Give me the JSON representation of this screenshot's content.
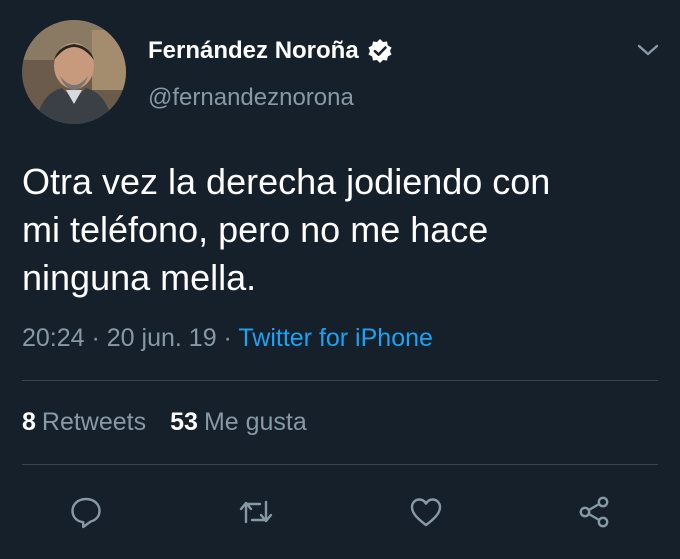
{
  "tweet": {
    "author": {
      "display_name": "Fernández Noroña",
      "handle": "@fernandeznorona",
      "verified": true,
      "avatar_icon": "profile-photo"
    },
    "text_lines": [
      "Otra vez la derecha jodiendo con",
      "mi teléfono, pero no me hace",
      "ninguna mella."
    ],
    "time": "20:24",
    "separator": " · ",
    "date": "20 jun. 19",
    "source": "Twitter for iPhone",
    "stats": {
      "retweets_count": "8",
      "retweets_label": "Retweets",
      "likes_count": "53",
      "likes_label": "Me gusta"
    },
    "actions": {
      "reply_icon": "reply-icon",
      "retweet_icon": "retweet-icon",
      "like_icon": "heart-icon",
      "share_icon": "share-icon"
    }
  },
  "colors": {
    "background": "#15202b",
    "text": "#ffffff",
    "secondary_text": "#8899a6",
    "link": "#1da1f2",
    "divider": "#38444d"
  }
}
